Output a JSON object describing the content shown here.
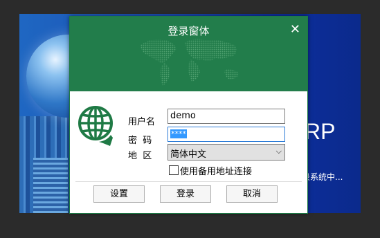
{
  "splash": {
    "brand_text": "RP",
    "status_text": "录系统中..."
  },
  "dialog": {
    "title": "登录窗体",
    "close_glyph": "✕",
    "fields": {
      "user_label": "用户名",
      "user_value": "demo",
      "password_label": "密  码",
      "password_value": "****",
      "region_label": "地  区",
      "region_value": "简体中文"
    },
    "checkbox_label": "使用备用地址连接",
    "buttons": {
      "settings": "设置",
      "login": "登录",
      "cancel": "取消"
    }
  },
  "colors": {
    "title_bg": "#227d4b",
    "logo": "#1f7a45",
    "selection": "#3399ff"
  }
}
